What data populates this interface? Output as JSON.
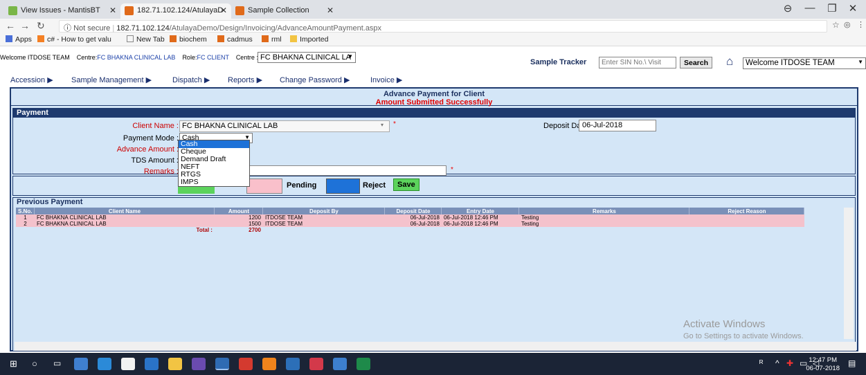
{
  "browser": {
    "tabs": [
      {
        "title": "View Issues - MantisBT",
        "active": false
      },
      {
        "title": "182.71.102.124/AtulayaD",
        "active": true
      },
      {
        "title": "Sample Collection",
        "active": false
      }
    ],
    "url_prefix": "Not secure",
    "url_host": "182.71.102.124",
    "url_path": "/AtulayaDemo/Design/Invoicing/AdvanceAmountPayment.aspx",
    "bookmarks": [
      "Apps",
      "c# - How to get valu",
      "New Tab",
      "biochem",
      "cadmus",
      "rml",
      "Imported"
    ]
  },
  "header": {
    "welcome": "Welcome ITDOSE TEAM",
    "centre_label": "Centre:",
    "centre_value": "FC BHAKNA CLINICAL LAB",
    "role_label": "Role:",
    "role_value": "FC CLIENT",
    "centre_select_label": "Centre :",
    "centre_select_value": "FC BHAKNA CLINICAL LA",
    "sample_tracker_label": "Sample Tracker",
    "sample_tracker_placeholder": "Enter SIN No.\\ Visit",
    "search_button": "Search",
    "user_select_value": "Welcome ITDOSE TEAM"
  },
  "menu": [
    "Accession ▶",
    "Sample Management ▶",
    "Dispatch ▶",
    "Reports ▶",
    "Change Password ▶",
    "Invoice ▶"
  ],
  "main": {
    "title": "Advance Payment for Client",
    "message": "Amount Submitted Successfully"
  },
  "payment": {
    "section_title": "Payment",
    "client_name_label": "Client Name :",
    "client_name_value": "FC BHAKNA CLINICAL LAB",
    "payment_mode_label": "Payment Mode :",
    "payment_mode_value": "Cash",
    "payment_mode_options": [
      "Cash",
      "Cheque",
      "Demand Draft",
      "NEFT",
      "RTGS",
      "IMPS"
    ],
    "advance_amount_label": "Advance Amount :",
    "tds_amount_label": "TDS Amount :",
    "remarks_label": "Remarks :",
    "deposit_date_label": "Deposit Date :",
    "deposit_date_value": "06-Jul-2018",
    "required_marker": "*"
  },
  "legend": {
    "pending_label": "Pending",
    "reject_label": "Reject",
    "save_button": "Save",
    "colors": {
      "approved": "#5cd35c",
      "pending": "#f9c0cb",
      "reject": "#1e72d8"
    }
  },
  "previous": {
    "section_title": "Previous Payment",
    "columns": [
      "S.No.",
      "Client Name",
      "Amount",
      "Deposit By",
      "Deposit Date",
      "Entry Date",
      "Remarks",
      "Reject Reason"
    ],
    "rows": [
      {
        "sno": "1",
        "client": "FC BHAKNA CLINICAL LAB",
        "amount": "1200",
        "deposit_by": "ITDOSE TEAM",
        "deposit_date": "06-Jul-2018",
        "entry_date": "06-Jul-2018 12:46 PM",
        "remarks": "Testing",
        "reject_reason": ""
      },
      {
        "sno": "2",
        "client": "FC BHAKNA CLINICAL LAB",
        "amount": "1500",
        "deposit_by": "ITDOSE TEAM",
        "deposit_date": "06-Jul-2018",
        "entry_date": "06-Jul-2018 12:46 PM",
        "remarks": "Testing",
        "reject_reason": ""
      }
    ],
    "total_label": "Total :",
    "total_value": "2700"
  },
  "watermark": {
    "line1": "Activate Windows",
    "line2": "Go to Settings to activate Windows."
  },
  "taskbar": {
    "time": "12:47 PM",
    "date": "06-07-2018"
  }
}
